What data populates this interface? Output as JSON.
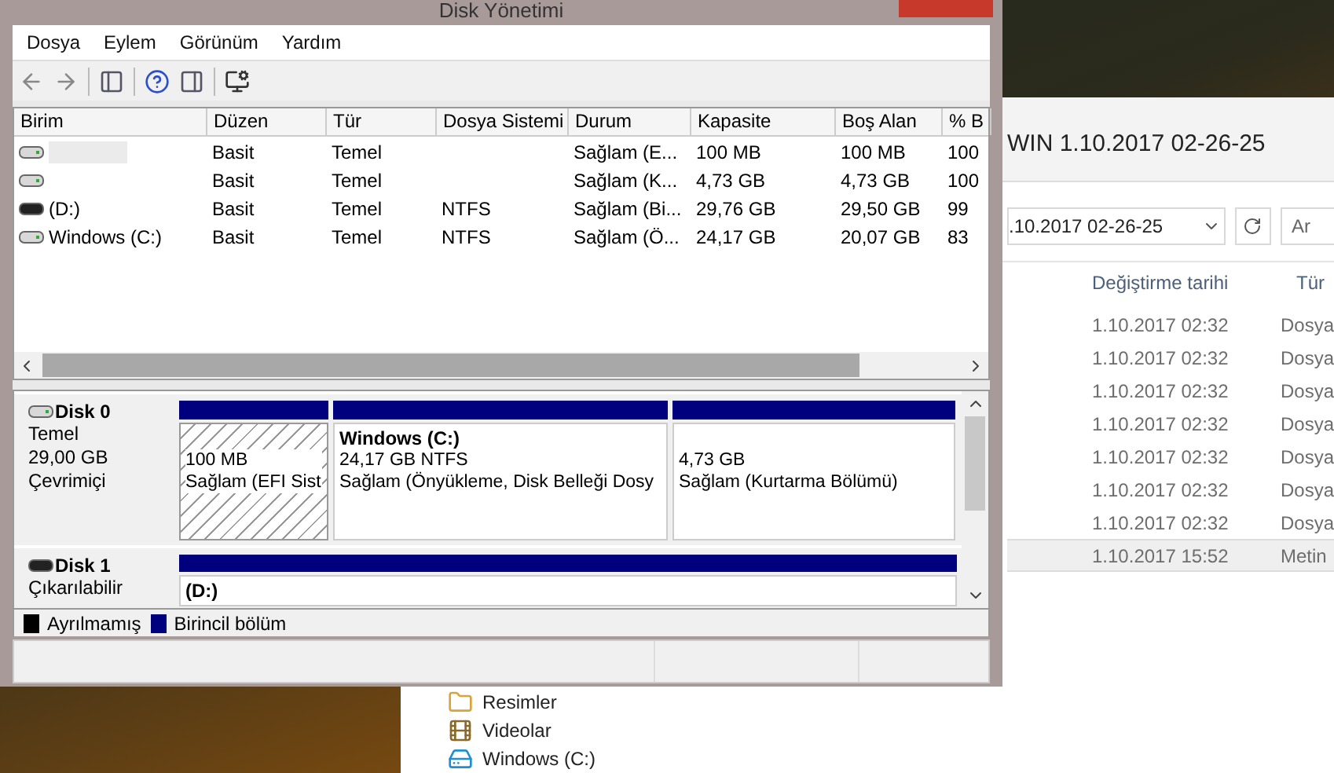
{
  "explorer": {
    "title": "WIN 1.10.2017 02-26-25",
    "address": ".10.2017 02-26-25",
    "search_placeholder": "Ar",
    "columns": [
      "Değiştirme tarihi",
      "Tür"
    ],
    "rows": [
      {
        "modified": "1.10.2017 02:32",
        "type": "Dosya",
        "selected": false
      },
      {
        "modified": "1.10.2017 02:32",
        "type": "Dosya",
        "selected": false
      },
      {
        "modified": "1.10.2017 02:32",
        "type": "Dosya",
        "selected": false
      },
      {
        "modified": "1.10.2017 02:32",
        "type": "Dosya",
        "selected": false
      },
      {
        "modified": "1.10.2017 02:32",
        "type": "Dosya",
        "selected": false
      },
      {
        "modified": "1.10.2017 02:32",
        "type": "Dosya",
        "selected": false
      },
      {
        "modified": "1.10.2017 02:32",
        "type": "Dosya",
        "selected": false
      },
      {
        "modified": "1.10.2017 15:52",
        "type": "Metin",
        "selected": true
      }
    ],
    "nav": [
      {
        "kind": "pictures",
        "label": "Resimler"
      },
      {
        "kind": "videos",
        "label": "Videolar"
      },
      {
        "kind": "drive",
        "label": "Windows (C:)"
      }
    ]
  },
  "disk_management": {
    "title": "Disk Yönetimi",
    "menu": [
      "Dosya",
      "Eylem",
      "Görünüm",
      "Yardım"
    ],
    "columns": [
      "Birim",
      "Düzen",
      "Tür",
      "Dosya Sistemi",
      "Durum",
      "Kapasite",
      "Boş Alan",
      "% B"
    ],
    "rows": [
      {
        "kind": "fixed",
        "redacted": true,
        "cells": [
          "",
          "Basit",
          "Temel",
          "",
          "Sağlam (E...",
          "100 MB",
          "100 MB",
          "100"
        ]
      },
      {
        "kind": "fixed",
        "redacted": false,
        "cells": [
          "",
          "Basit",
          "Temel",
          "",
          "Sağlam (K...",
          "4,73 GB",
          "4,73 GB",
          "100"
        ]
      },
      {
        "kind": "removable",
        "redacted": false,
        "cells": [
          "(D:)",
          "Basit",
          "Temel",
          "NTFS",
          "Sağlam (Bi...",
          "29,76 GB",
          "29,50 GB",
          "99"
        ]
      },
      {
        "kind": "fixed",
        "redacted": false,
        "cells": [
          "Windows (C:)",
          "Basit",
          "Temel",
          "NTFS",
          "Sağlam (Ö...",
          "24,17 GB",
          "20,07 GB",
          "83"
        ]
      }
    ],
    "disks": [
      {
        "kind": "fixed",
        "name": "Disk 0",
        "info": [
          "Temel",
          "29,00 GB",
          "Çevrimiçi"
        ],
        "partitions": [
          {
            "selected": true,
            "lines": [
              "100 MB",
              "Sağlam (EFI Sist"
            ]
          },
          {
            "selected": false,
            "title": "Windows  (C:)",
            "lines": [
              "24,17 GB NTFS",
              "Sağlam (Önyükleme, Disk Belleği Dosy"
            ]
          },
          {
            "selected": false,
            "lines": [
              "4,73 GB",
              "Sağlam (Kurtarma Bölümü)"
            ]
          }
        ]
      },
      {
        "kind": "removable",
        "name": "Disk 1",
        "info": [
          "Çıkarılabilir"
        ],
        "partitions": [
          {
            "selected": false,
            "title": "(D:)"
          }
        ]
      }
    ],
    "legend": [
      {
        "label": "Ayrılmamış",
        "color": "#000000"
      },
      {
        "label": "Birincil bölüm",
        "color": "#00007f"
      }
    ]
  }
}
